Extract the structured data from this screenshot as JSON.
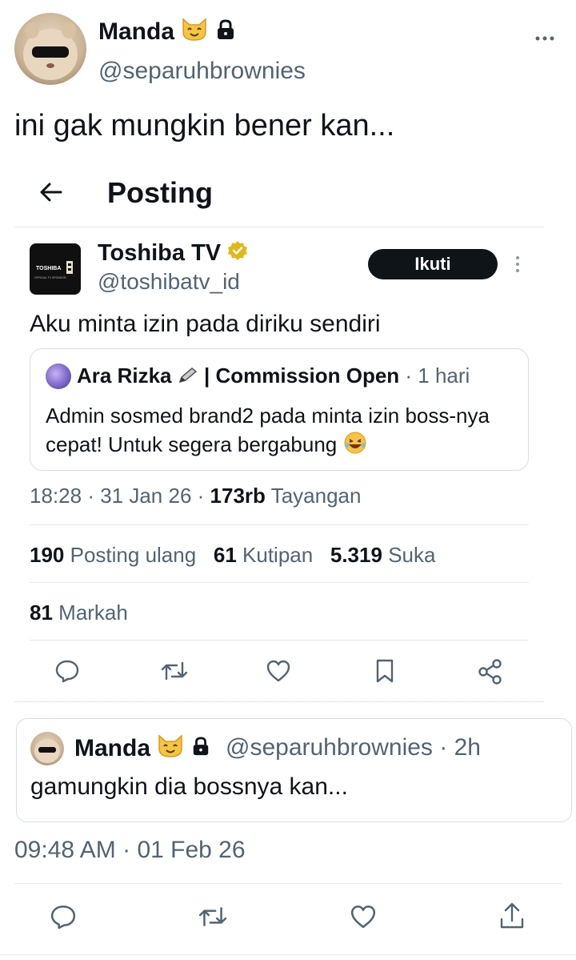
{
  "outer_post": {
    "author_name": "Manda",
    "author_handle": "@separuhbrownies",
    "text": "ini gak mungkin bener kan..."
  },
  "inner_screenshot": {
    "header_title": "Posting",
    "post": {
      "author_name": "Toshiba TV",
      "author_handle": "@toshibatv_id",
      "follow_label": "Ikuti",
      "logo_text": "TOSHIBA",
      "logo_subtext": "OFFICIAL TV SPONSOR",
      "text": "Aku minta izin pada diriku sendiri",
      "quoted": {
        "author": "Ara Rizka",
        "author_suffix": "| Commission Open",
        "time": "· 1 hari",
        "text": "Admin sosmed brand2 pada minta izin boss-nya cepat! Untuk segera bergabung"
      },
      "time": "18:28",
      "date": "31 Jan 26",
      "views_count": "173rb",
      "views_label": "Tayangan",
      "reposts_count": "190",
      "reposts_label": "Posting ulang",
      "quotes_count": "61",
      "quotes_label": "Kutipan",
      "likes_count": "5.319",
      "likes_label": "Suka",
      "bookmarks_count": "81",
      "bookmarks_label": "Markah"
    }
  },
  "reply": {
    "author_name": "Manda",
    "author_handle": "@separuhbrownies",
    "time": "· 2h",
    "text": "gamungkin dia bossnya kan..."
  },
  "outer_meta": {
    "time": "09:48 AM",
    "date": "01 Feb 26"
  },
  "icons": [
    "more-icon",
    "back-arrow-icon",
    "verified-badge-icon",
    "reply-icon",
    "repost-icon",
    "like-icon",
    "bookmark-icon",
    "share-icon",
    "lock-icon",
    "cat-emoji-icon"
  ],
  "colors": {
    "text": "#0f1419",
    "muted": "#536471",
    "verified": "#e2b719",
    "border": "#e6e9ec"
  }
}
